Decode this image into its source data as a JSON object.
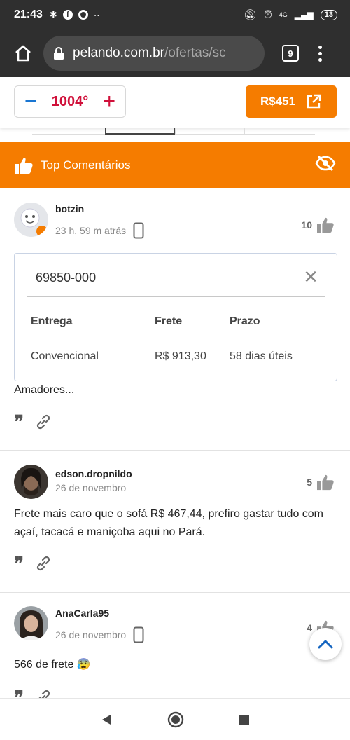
{
  "status_bar": {
    "time": "21:43",
    "battery": "13",
    "network": "4G"
  },
  "browser": {
    "url_host": "pelando.com.br",
    "url_path": "/ofertas/sc",
    "tab_count": "9"
  },
  "deal": {
    "temperature": "1004°",
    "price_button": "R$451"
  },
  "top_comments": {
    "label": "Top Comentários"
  },
  "comments": [
    {
      "username": "botzin",
      "time": "23 h, 59 m atrás",
      "likes": "10",
      "text": "Amadores..."
    },
    {
      "username": "edson.dropnildo",
      "time": "26 de novembro",
      "likes": "5",
      "text": "Frete mais caro que o sofá R$ 467,44, prefiro gastar tudo com açaí, tacacá e maniçoba aqui no Pará."
    },
    {
      "username": "AnaCarla95",
      "time": "26 de novembro",
      "likes": "4",
      "text": "566 de frete 😰"
    }
  ],
  "shipping": {
    "cep": "69850-000",
    "headers": [
      "Entrega",
      "Frete",
      "Prazo"
    ],
    "row": [
      "Convencional",
      "R$ 913,30",
      "58 dias úteis"
    ]
  },
  "colors": {
    "accent": "#f57c00",
    "temperature": "#d0103a",
    "minus": "#1976d2",
    "statusbar": "#2f2f2f"
  }
}
